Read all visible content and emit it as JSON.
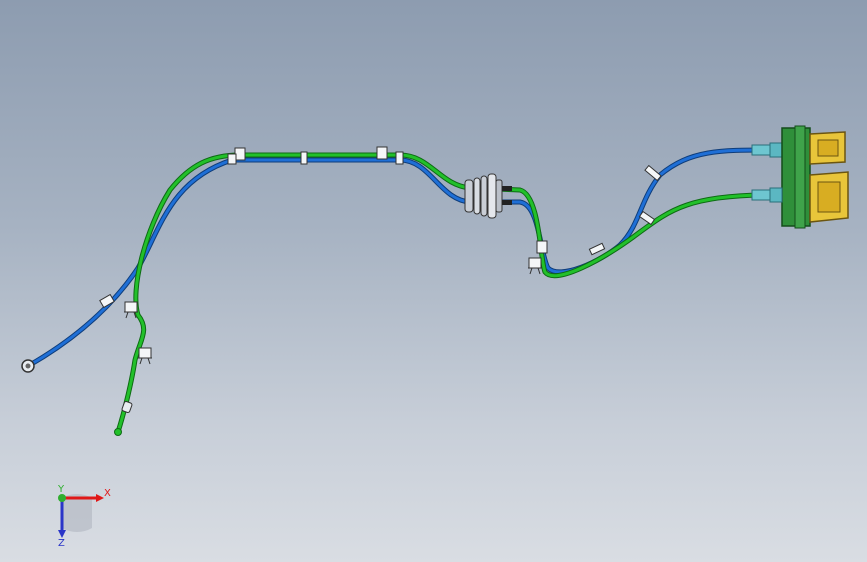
{
  "viewport": {
    "background_top": "#8d9cb0",
    "background_bottom": "#d9dde3"
  },
  "cables": {
    "blue_color": "#1f6fd6",
    "green_color": "#22c02a",
    "connector_color": "#2f8f3a",
    "housing_color": "#e8c53a"
  },
  "triad": {
    "x_label": "X",
    "y_label": "Y",
    "z_label": "Z",
    "x_color": "#e01818",
    "y_color": "#2fae2f",
    "z_color": "#2a35c8"
  }
}
